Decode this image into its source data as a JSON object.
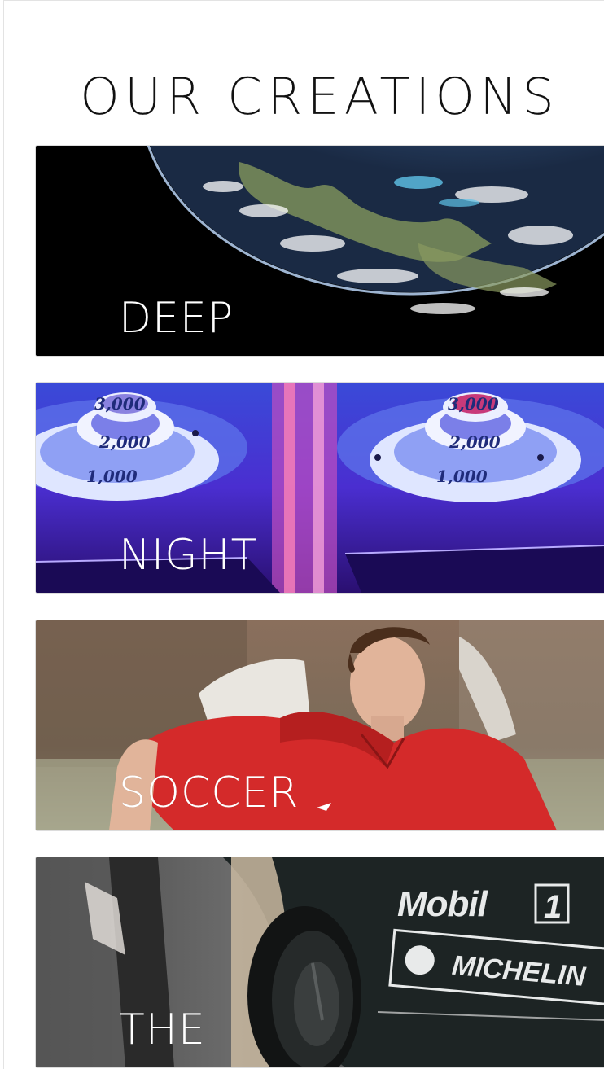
{
  "section": {
    "title": "OUR CREATIONS"
  },
  "cards": [
    {
      "label": "DEEP",
      "image": "earth-from-space-image"
    },
    {
      "label": "NIGHT",
      "image": "arcade-skee-ball-image",
      "score_labels": [
        "3,000",
        "2,000",
        "1,000"
      ]
    },
    {
      "label": "SOCCER",
      "image": "soccer-player-image"
    },
    {
      "label": "THE",
      "image": "race-car-image",
      "sponsor_labels": [
        "Mobil",
        "1",
        "MICHELIN"
      ]
    }
  ],
  "colors": {
    "background": "#ffffff",
    "title": "#111111",
    "card_label": "#ffffff"
  }
}
